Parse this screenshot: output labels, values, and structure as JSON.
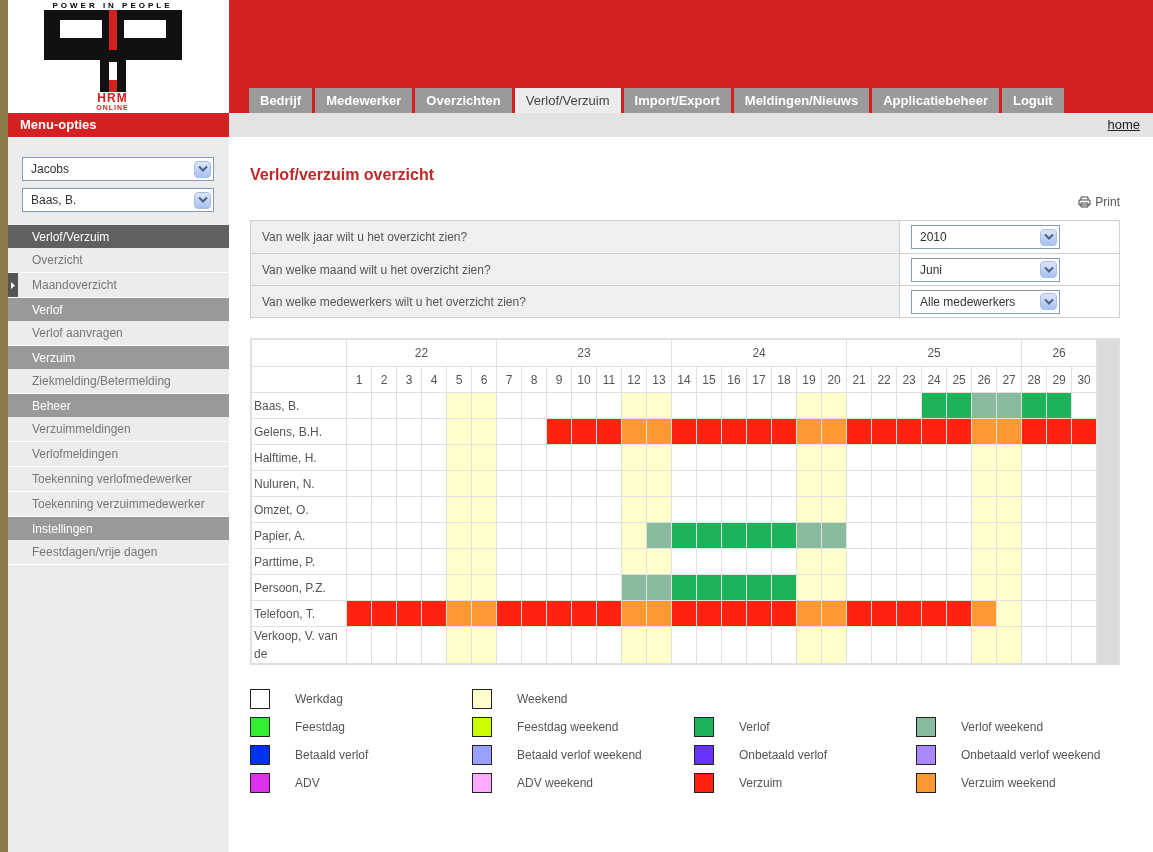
{
  "logo": {
    "tagline": "POWER IN PEOPLE",
    "line_1": "HRM",
    "line_2": "ONLINE"
  },
  "tabs": [
    {
      "label": "Bedrijf",
      "selected": false
    },
    {
      "label": "Medewerker",
      "selected": false
    },
    {
      "label": "Overzichten",
      "selected": false
    },
    {
      "label": "Verlof/Verzuim",
      "selected": true
    },
    {
      "label": "Import/Export",
      "selected": false
    },
    {
      "label": "Meldingen/Nieuws",
      "selected": false
    },
    {
      "label": "Applicatiebeheer",
      "selected": false
    },
    {
      "label": "Loguit",
      "selected": false
    }
  ],
  "home_link": "home",
  "sidebar": {
    "title": "Menu-opties",
    "selects": [
      {
        "value": "Jacobs"
      },
      {
        "value": "Baas, B."
      }
    ],
    "sections": [
      {
        "heading": "Verlof/Verzuim",
        "selected": true,
        "items": [
          {
            "label": "Overzicht",
            "selected": false
          },
          {
            "label": "Maandoverzicht",
            "selected": true
          }
        ]
      },
      {
        "heading": "Verlof",
        "selected": false,
        "items": [
          {
            "label": "Verlof aanvragen",
            "selected": false
          }
        ]
      },
      {
        "heading": "Verzuim",
        "selected": false,
        "items": [
          {
            "label": "Ziekmelding/Betermelding",
            "selected": false
          }
        ]
      },
      {
        "heading": "Beheer",
        "selected": false,
        "items": [
          {
            "label": "Verzuimmeldingen",
            "selected": false
          },
          {
            "label": "Verlofmeldingen",
            "selected": false
          },
          {
            "label": "Toekenning verlofmedewerker",
            "selected": false
          },
          {
            "label": "Toekenning verzuimmedewerker",
            "selected": false
          }
        ]
      },
      {
        "heading": "Instellingen",
        "selected": false,
        "items": [
          {
            "label": "Feestdagen/vrije dagen",
            "selected": false
          }
        ]
      }
    ]
  },
  "page_title": "Verlof/verzuim overzicht",
  "print_link": "Print",
  "filters": [
    {
      "question": "Van welk jaar wilt u het overzicht zien?",
      "value": "2010"
    },
    {
      "question": "Van welke maand wilt u het overzicht zien?",
      "value": "Juni"
    },
    {
      "question": "Van welke medewerkers wilt u het overzicht zien?",
      "value": "Alle medewerkers"
    }
  ],
  "calendar": {
    "weeks": [
      {
        "label": "22",
        "days": [
          "1",
          "2",
          "3",
          "4",
          "5",
          "6"
        ]
      },
      {
        "label": "23",
        "days": [
          "7",
          "8",
          "9",
          "10",
          "11",
          "12",
          "13"
        ]
      },
      {
        "label": "24",
        "days": [
          "14",
          "15",
          "16",
          "17",
          "18",
          "19",
          "20"
        ]
      },
      {
        "label": "25",
        "days": [
          "21",
          "22",
          "23",
          "24",
          "25",
          "26",
          "27"
        ]
      },
      {
        "label": "26",
        "days": [
          "28",
          "29",
          "30"
        ]
      }
    ],
    "rows": [
      {
        "name": "Baas, B.",
        "cells": [
          {
            "kind": "werkdag"
          },
          {
            "kind": "werkdag"
          },
          {
            "kind": "werkdag"
          },
          {
            "kind": "werkdag"
          },
          {
            "kind": "weekend"
          },
          {
            "kind": "weekend"
          },
          {
            "kind": "werkdag"
          },
          {
            "kind": "werkdag"
          },
          {
            "kind": "werkdag"
          },
          {
            "kind": "werkdag"
          },
          {
            "kind": "werkdag"
          },
          {
            "kind": "weekend"
          },
          {
            "kind": "weekend"
          },
          {
            "kind": "werkdag"
          },
          {
            "kind": "werkdag"
          },
          {
            "kind": "werkdag"
          },
          {
            "kind": "werkdag"
          },
          {
            "kind": "werkdag"
          },
          {
            "kind": "weekend"
          },
          {
            "kind": "weekend"
          },
          {
            "kind": "werkdag"
          },
          {
            "kind": "werkdag"
          },
          {
            "kind": "werkdag"
          },
          {
            "kind": "verlof"
          },
          {
            "kind": "verlof"
          },
          {
            "kind": "verlofweekend"
          },
          {
            "kind": "verlofweekend"
          },
          {
            "kind": "verlof"
          },
          {
            "kind": "verlof"
          },
          {
            "kind": "werkdag"
          }
        ]
      },
      {
        "name": "Gelens, B.H.",
        "cells": [
          {
            "kind": "werkdag"
          },
          {
            "kind": "werkdag"
          },
          {
            "kind": "werkdag"
          },
          {
            "kind": "werkdag"
          },
          {
            "kind": "weekend"
          },
          {
            "kind": "weekend"
          },
          {
            "kind": "werkdag"
          },
          {
            "kind": "werkdag"
          },
          {
            "kind": "verzuim"
          },
          {
            "kind": "verzuim"
          },
          {
            "kind": "verzuim"
          },
          {
            "kind": "verzuimweekend"
          },
          {
            "kind": "verzuimweekend"
          },
          {
            "kind": "verzuim"
          },
          {
            "kind": "verzuim"
          },
          {
            "kind": "verzuim"
          },
          {
            "kind": "verzuim"
          },
          {
            "kind": "verzuim"
          },
          {
            "kind": "verzuimweekend"
          },
          {
            "kind": "verzuimweekend"
          },
          {
            "kind": "verzuim"
          },
          {
            "kind": "verzuim"
          },
          {
            "kind": "verzuim"
          },
          {
            "kind": "verzuim"
          },
          {
            "kind": "verzuim"
          },
          {
            "kind": "verzuimweekend"
          },
          {
            "kind": "verzuimweekend"
          },
          {
            "kind": "verzuim"
          },
          {
            "kind": "verzuim"
          },
          {
            "kind": "verzuim"
          }
        ]
      },
      {
        "name": "Halftime, H.",
        "cells": [
          {
            "kind": "werkdag"
          },
          {
            "kind": "werkdag"
          },
          {
            "kind": "werkdag"
          },
          {
            "kind": "werkdag"
          },
          {
            "kind": "weekend"
          },
          {
            "kind": "weekend"
          },
          {
            "kind": "werkdag"
          },
          {
            "kind": "werkdag"
          },
          {
            "kind": "werkdag"
          },
          {
            "kind": "werkdag"
          },
          {
            "kind": "werkdag"
          },
          {
            "kind": "weekend"
          },
          {
            "kind": "weekend"
          },
          {
            "kind": "werkdag"
          },
          {
            "kind": "werkdag"
          },
          {
            "kind": "werkdag"
          },
          {
            "kind": "werkdag"
          },
          {
            "kind": "werkdag"
          },
          {
            "kind": "weekend"
          },
          {
            "kind": "weekend"
          },
          {
            "kind": "werkdag"
          },
          {
            "kind": "werkdag"
          },
          {
            "kind": "werkdag"
          },
          {
            "kind": "werkdag"
          },
          {
            "kind": "werkdag"
          },
          {
            "kind": "weekend"
          },
          {
            "kind": "weekend"
          },
          {
            "kind": "werkdag"
          },
          {
            "kind": "werkdag"
          },
          {
            "kind": "werkdag"
          }
        ]
      },
      {
        "name": "Nuluren, N.",
        "cells": [
          {
            "kind": "werkdag"
          },
          {
            "kind": "werkdag"
          },
          {
            "kind": "werkdag"
          },
          {
            "kind": "werkdag"
          },
          {
            "kind": "weekend"
          },
          {
            "kind": "weekend"
          },
          {
            "kind": "werkdag"
          },
          {
            "kind": "werkdag"
          },
          {
            "kind": "werkdag"
          },
          {
            "kind": "werkdag"
          },
          {
            "kind": "werkdag"
          },
          {
            "kind": "weekend"
          },
          {
            "kind": "weekend"
          },
          {
            "kind": "werkdag"
          },
          {
            "kind": "werkdag"
          },
          {
            "kind": "werkdag"
          },
          {
            "kind": "werkdag"
          },
          {
            "kind": "werkdag"
          },
          {
            "kind": "weekend"
          },
          {
            "kind": "weekend"
          },
          {
            "kind": "werkdag"
          },
          {
            "kind": "werkdag"
          },
          {
            "kind": "werkdag"
          },
          {
            "kind": "werkdag"
          },
          {
            "kind": "werkdag"
          },
          {
            "kind": "weekend"
          },
          {
            "kind": "weekend"
          },
          {
            "kind": "werkdag"
          },
          {
            "kind": "werkdag"
          },
          {
            "kind": "werkdag"
          }
        ]
      },
      {
        "name": "Omzet, O.",
        "cells": [
          {
            "kind": "werkdag"
          },
          {
            "kind": "werkdag"
          },
          {
            "kind": "werkdag"
          },
          {
            "kind": "werkdag"
          },
          {
            "kind": "weekend"
          },
          {
            "kind": "weekend"
          },
          {
            "kind": "werkdag"
          },
          {
            "kind": "werkdag"
          },
          {
            "kind": "werkdag"
          },
          {
            "kind": "werkdag"
          },
          {
            "kind": "werkdag"
          },
          {
            "kind": "weekend"
          },
          {
            "kind": "weekend"
          },
          {
            "kind": "werkdag"
          },
          {
            "kind": "werkdag"
          },
          {
            "kind": "werkdag"
          },
          {
            "kind": "werkdag"
          },
          {
            "kind": "werkdag"
          },
          {
            "kind": "weekend"
          },
          {
            "kind": "weekend"
          },
          {
            "kind": "werkdag"
          },
          {
            "kind": "werkdag"
          },
          {
            "kind": "werkdag"
          },
          {
            "kind": "werkdag"
          },
          {
            "kind": "werkdag"
          },
          {
            "kind": "weekend"
          },
          {
            "kind": "weekend"
          },
          {
            "kind": "werkdag"
          },
          {
            "kind": "werkdag"
          },
          {
            "kind": "werkdag"
          }
        ]
      },
      {
        "name": "Papier, A.",
        "cells": [
          {
            "kind": "werkdag"
          },
          {
            "kind": "werkdag"
          },
          {
            "kind": "werkdag"
          },
          {
            "kind": "werkdag"
          },
          {
            "kind": "weekend"
          },
          {
            "kind": "weekend"
          },
          {
            "kind": "werkdag"
          },
          {
            "kind": "werkdag"
          },
          {
            "kind": "werkdag"
          },
          {
            "kind": "werkdag"
          },
          {
            "kind": "werkdag"
          },
          {
            "kind": "weekend"
          },
          {
            "kind": "verlofweekend"
          },
          {
            "kind": "verlof"
          },
          {
            "kind": "verlof"
          },
          {
            "kind": "verlof"
          },
          {
            "kind": "verlof"
          },
          {
            "kind": "verlof"
          },
          {
            "kind": "verlofweekend"
          },
          {
            "kind": "verlofweekend"
          },
          {
            "kind": "werkdag"
          },
          {
            "kind": "werkdag"
          },
          {
            "kind": "werkdag"
          },
          {
            "kind": "werkdag"
          },
          {
            "kind": "werkdag"
          },
          {
            "kind": "weekend"
          },
          {
            "kind": "weekend"
          },
          {
            "kind": "werkdag"
          },
          {
            "kind": "werkdag"
          },
          {
            "kind": "werkdag"
          }
        ]
      },
      {
        "name": "Parttime, P.",
        "cells": [
          {
            "kind": "werkdag"
          },
          {
            "kind": "werkdag"
          },
          {
            "kind": "werkdag"
          },
          {
            "kind": "werkdag"
          },
          {
            "kind": "weekend"
          },
          {
            "kind": "weekend"
          },
          {
            "kind": "werkdag"
          },
          {
            "kind": "werkdag"
          },
          {
            "kind": "werkdag"
          },
          {
            "kind": "werkdag"
          },
          {
            "kind": "werkdag"
          },
          {
            "kind": "weekend"
          },
          {
            "kind": "weekend"
          },
          {
            "kind": "werkdag"
          },
          {
            "kind": "werkdag"
          },
          {
            "kind": "werkdag"
          },
          {
            "kind": "werkdag"
          },
          {
            "kind": "werkdag"
          },
          {
            "kind": "weekend"
          },
          {
            "kind": "weekend"
          },
          {
            "kind": "werkdag"
          },
          {
            "kind": "werkdag"
          },
          {
            "kind": "werkdag"
          },
          {
            "kind": "werkdag"
          },
          {
            "kind": "werkdag"
          },
          {
            "kind": "weekend"
          },
          {
            "kind": "weekend"
          },
          {
            "kind": "werkdag"
          },
          {
            "kind": "werkdag"
          },
          {
            "kind": "werkdag"
          }
        ]
      },
      {
        "name": "Persoon, P.Z.",
        "cells": [
          {
            "kind": "werkdag"
          },
          {
            "kind": "werkdag"
          },
          {
            "kind": "werkdag"
          },
          {
            "kind": "werkdag"
          },
          {
            "kind": "weekend"
          },
          {
            "kind": "weekend"
          },
          {
            "kind": "werkdag"
          },
          {
            "kind": "werkdag"
          },
          {
            "kind": "werkdag"
          },
          {
            "kind": "werkdag"
          },
          {
            "kind": "werkdag"
          },
          {
            "kind": "verlofweekend"
          },
          {
            "kind": "verlofweekend"
          },
          {
            "kind": "verlof"
          },
          {
            "kind": "verlof"
          },
          {
            "kind": "verlof"
          },
          {
            "kind": "verlof"
          },
          {
            "kind": "verlof"
          },
          {
            "kind": "weekend"
          },
          {
            "kind": "weekend"
          },
          {
            "kind": "werkdag"
          },
          {
            "kind": "werkdag"
          },
          {
            "kind": "werkdag"
          },
          {
            "kind": "werkdag"
          },
          {
            "kind": "werkdag"
          },
          {
            "kind": "weekend"
          },
          {
            "kind": "weekend"
          },
          {
            "kind": "werkdag"
          },
          {
            "kind": "werkdag"
          },
          {
            "kind": "werkdag"
          }
        ]
      },
      {
        "name": "Telefoon, T.",
        "cells": [
          {
            "kind": "verzuim"
          },
          {
            "kind": "verzuim"
          },
          {
            "kind": "verzuim"
          },
          {
            "kind": "verzuim"
          },
          {
            "kind": "verzuimweekend"
          },
          {
            "kind": "verzuimweekend"
          },
          {
            "kind": "verzuim"
          },
          {
            "kind": "verzuim"
          },
          {
            "kind": "verzuim"
          },
          {
            "kind": "verzuim"
          },
          {
            "kind": "verzuim"
          },
          {
            "kind": "verzuimweekend"
          },
          {
            "kind": "verzuimweekend"
          },
          {
            "kind": "verzuim"
          },
          {
            "kind": "verzuim"
          },
          {
            "kind": "verzuim"
          },
          {
            "kind": "verzuim"
          },
          {
            "kind": "verzuim"
          },
          {
            "kind": "verzuimweekend"
          },
          {
            "kind": "verzuimweekend"
          },
          {
            "kind": "verzuim"
          },
          {
            "kind": "verzuim"
          },
          {
            "kind": "verzuim"
          },
          {
            "kind": "verzuim"
          },
          {
            "kind": "verzuim"
          },
          {
            "kind": "verzuimweekend"
          },
          {
            "kind": "weekend"
          },
          {
            "kind": "werkdag"
          },
          {
            "kind": "werkdag"
          },
          {
            "kind": "werkdag"
          }
        ]
      },
      {
        "name": "Verkoop, V. van de",
        "cells": [
          {
            "kind": "werkdag"
          },
          {
            "kind": "werkdag"
          },
          {
            "kind": "werkdag"
          },
          {
            "kind": "werkdag"
          },
          {
            "kind": "weekend"
          },
          {
            "kind": "weekend"
          },
          {
            "kind": "werkdag"
          },
          {
            "kind": "werkdag"
          },
          {
            "kind": "werkdag"
          },
          {
            "kind": "werkdag"
          },
          {
            "kind": "werkdag"
          },
          {
            "kind": "weekend"
          },
          {
            "kind": "weekend"
          },
          {
            "kind": "werkdag"
          },
          {
            "kind": "werkdag"
          },
          {
            "kind": "werkdag"
          },
          {
            "kind": "werkdag"
          },
          {
            "kind": "werkdag"
          },
          {
            "kind": "weekend"
          },
          {
            "kind": "weekend"
          },
          {
            "kind": "werkdag"
          },
          {
            "kind": "werkdag"
          },
          {
            "kind": "werkdag"
          },
          {
            "kind": "werkdag"
          },
          {
            "kind": "werkdag"
          },
          {
            "kind": "weekend"
          },
          {
            "kind": "weekend"
          },
          {
            "kind": "werkdag"
          },
          {
            "kind": "werkdag"
          },
          {
            "kind": "werkdag"
          }
        ]
      }
    ]
  },
  "legend": [
    [
      {
        "kind": "werkdag",
        "label": "Werkdag",
        "color": "#ffffff"
      },
      {
        "kind": "weekend",
        "label": "Weekend",
        "color": "#ffffcc"
      }
    ],
    [
      {
        "kind": "feestdag",
        "label": "Feestdag",
        "color": "#33ee33"
      },
      {
        "kind": "feestdagweekend",
        "label": "Feestdag weekend",
        "color": "#ccff00"
      },
      {
        "kind": "verlof",
        "label": "Verlof",
        "color": "#1eb25a"
      },
      {
        "kind": "verlofweekend",
        "label": "Verlof weekend",
        "color": "#88bb9e"
      }
    ],
    [
      {
        "kind": "betaald",
        "label": "Betaald verlof",
        "color": "#0033ee"
      },
      {
        "kind": "betaaldweekend",
        "label": "Betaald verlof weekend",
        "color": "#99a0ff"
      },
      {
        "kind": "onbetaald",
        "label": "Onbetaald verlof",
        "color": "#6633ff"
      },
      {
        "kind": "onbetaaldweekend",
        "label": "Onbetaald verlof weekend",
        "color": "#aa88ff"
      }
    ],
    [
      {
        "kind": "adv",
        "label": "ADV",
        "color": "#dd33ee"
      },
      {
        "kind": "advweekend",
        "label": "ADV weekend",
        "color": "#ffaaff"
      },
      {
        "kind": "verzuim",
        "label": "Verzuim",
        "color": "#ff2211"
      },
      {
        "kind": "verzuimweekend",
        "label": "Verzuim weekend",
        "color": "#ff9933"
      }
    ]
  ]
}
